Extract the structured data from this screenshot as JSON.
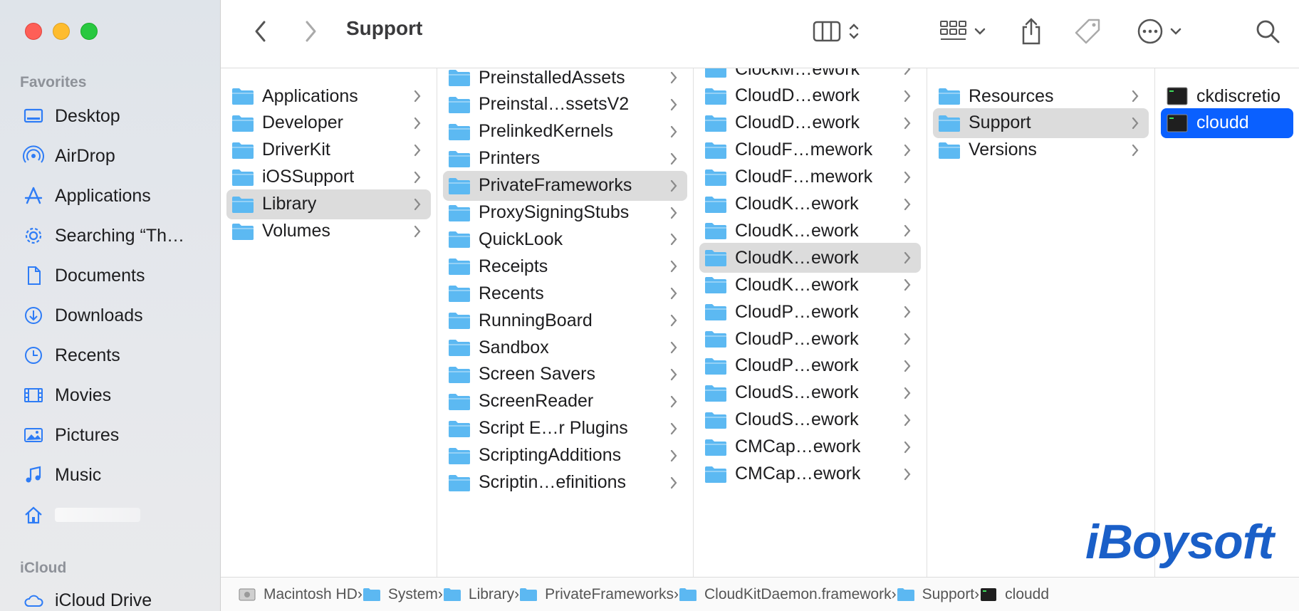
{
  "window": {
    "title": "Support"
  },
  "colors": {
    "folder": "#5cb8f2",
    "selection_active": "#0a60ff",
    "selection_inactive": "#dcdcdc",
    "watermark": "#1a5fc8"
  },
  "sidebar": {
    "favorites_label": "Favorites",
    "items": [
      {
        "label": "Desktop",
        "icon": "desktop-icon"
      },
      {
        "label": "AirDrop",
        "icon": "airdrop-icon"
      },
      {
        "label": "Applications",
        "icon": "applications-icon"
      },
      {
        "label": "Searching “Th…",
        "icon": "gear-icon"
      },
      {
        "label": "Documents",
        "icon": "document-icon"
      },
      {
        "label": "Downloads",
        "icon": "download-icon"
      },
      {
        "label": "Recents",
        "icon": "clock-icon"
      },
      {
        "label": "Movies",
        "icon": "film-icon"
      },
      {
        "label": "Pictures",
        "icon": "photo-icon"
      },
      {
        "label": "Music",
        "icon": "music-icon"
      },
      {
        "label": "",
        "icon": "home-icon"
      }
    ],
    "icloud_label": "iCloud",
    "icloud_items": [
      {
        "label": "iCloud Drive",
        "icon": "cloud-icon"
      }
    ]
  },
  "columns": [
    {
      "items": [
        "Applications",
        "Developer",
        "DriverKit",
        "iOSSupport",
        "Library",
        "Volumes"
      ],
      "selected": 4
    },
    {
      "items": [
        "PreinstalledAssets",
        "Preinstal…ssetsV2",
        "PrelinkedKernels",
        "Printers",
        "PrivateFrameworks",
        "ProxySigningStubs",
        "QuickLook",
        "Receipts",
        "Recents",
        "RunningBoard",
        "Sandbox",
        "Screen Savers",
        "ScreenReader",
        "Script E…r Plugins",
        "ScriptingAdditions",
        "Scriptin…efinitions"
      ],
      "selected": 4
    },
    {
      "items": [
        "ClockM…ework",
        "CloudD…ework",
        "CloudD…ework",
        "CloudF…mework",
        "CloudF…mework",
        "CloudK…ework",
        "CloudK…ework",
        "CloudK…ework",
        "CloudK…ework",
        "CloudP…ework",
        "CloudP…ework",
        "CloudP…ework",
        "CloudS…ework",
        "CloudS…ework",
        "CMCap…ework",
        "CMCap…ework"
      ],
      "selected": 7
    },
    {
      "items": [
        "Resources",
        "Support",
        "Versions"
      ],
      "selected": 1
    },
    {
      "items": [
        "ckdiscretio",
        "cloudd"
      ],
      "selected": 1
    }
  ],
  "pathbar": [
    "Macintosh HD",
    "System",
    "Library",
    "PrivateFrameworks",
    "CloudKitDaemon.framework",
    "Support",
    "cloudd"
  ],
  "watermark": "iBoysoft"
}
